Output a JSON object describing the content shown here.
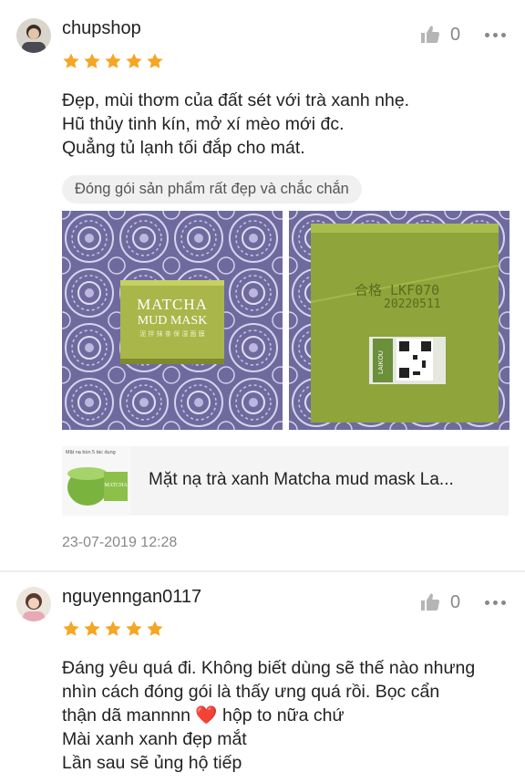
{
  "reviews": [
    {
      "username": "chupshop",
      "rating": 5,
      "likes": "0",
      "text_lines": [
        "Đẹp, mùi thơm của đất sét với trà xanh nhẹ.",
        "Hũ thủy tinh kín, mở xí mèo mới đc.",
        "Quẳng tủ lạnh tối đắp cho mát."
      ],
      "tag": "Đóng gói sản phẩm rất đẹp và chắc chắn",
      "photo1": {
        "product_line1": "MATCHA",
        "product_line2": "MUD MASK",
        "product_line3": "泥 拌 抹 茶 保 湿 面 膜"
      },
      "photo2": {
        "print_line1": "合格 LKF070",
        "print_line2": "20220511",
        "label_text": "LAIKOU"
      },
      "product": {
        "name": "Mặt nạ trà xanh Matcha mud mask La...",
        "thumb_banner": "Mặt nạ bùn 5 tác dụng",
        "thumb_jar_label": "MATCHA"
      },
      "date": "23-07-2019 12:28"
    },
    {
      "username": "nguyenngan0117",
      "rating": 5,
      "likes": "0",
      "text_lines": [
        "Đáng yêu quá đi. Không biết dùng sẽ thế nào nhưng",
        "nhìn cách đóng gói là thấy ưng quá rồi. Bọc cẩn",
        "thận dã mannnn ❤️ hộp to nữa chứ",
        "Mài xanh xanh đẹp mắt",
        "Lần sau sẽ ủng hộ tiếp"
      ]
    }
  ],
  "colors": {
    "star": "#f5a623",
    "muted": "#888888",
    "chip_bg": "#f0f0f0",
    "product_bg": "#f4f4f4",
    "heart": "#e53935"
  },
  "icons": [
    "thumbs-up-icon",
    "more-icon",
    "star-icon",
    "heart-icon"
  ]
}
